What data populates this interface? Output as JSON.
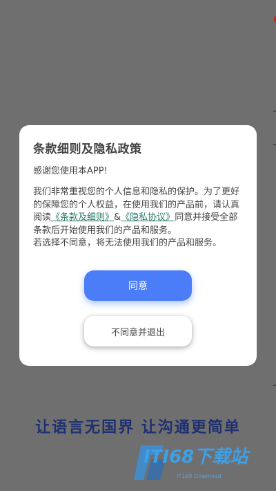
{
  "dialog": {
    "title": "条款细则及隐私政策",
    "greeting": "感谢您使用本APP!",
    "para1_before": "我们非常重视您的个人信息和隐私的保护。为了更好的保障您的个人权益，在使用我们的产品前，请认真阅读",
    "terms_link": "《条款及细则》",
    "amp": "&",
    "privacy_link": "《隐私协议》",
    "para1_after": "同意并接受全部条款后开始使用我们的产品和服务。",
    "para2": "若选择不同意，将无法使用我们的产品和服务。",
    "agree_label": "同意",
    "decline_label": "不同意并退出"
  },
  "slogan": "让语言无国界 让沟通更简单",
  "watermark": {
    "text": "ITI68下载站",
    "sub": "IT168 Download"
  },
  "colors": {
    "overlay": "#6f6f6f",
    "accent": "#4a7df7",
    "link": "#2b7a6b",
    "slogan": "#1f3070"
  }
}
